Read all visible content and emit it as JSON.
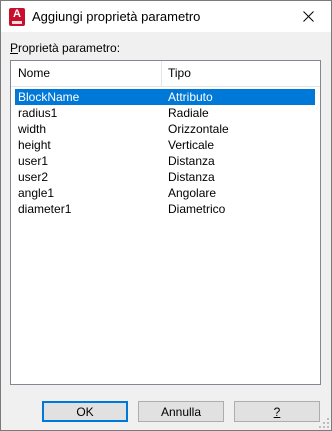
{
  "window": {
    "title": "Aggiungi proprietà parametro",
    "app_icon": "autocad-logo-icon",
    "app_icon_letter": "A",
    "accent_color": "#c8102e"
  },
  "section": {
    "label": "Proprietà parametro:"
  },
  "table": {
    "columns": [
      "Nome",
      "Tipo"
    ],
    "selected_index": 0,
    "selection_color": "#0078d7",
    "rows": [
      {
        "name": "BlockName",
        "type": "Attributo"
      },
      {
        "name": "radius1",
        "type": "Radiale"
      },
      {
        "name": "width",
        "type": "Orizzontale"
      },
      {
        "name": "height",
        "type": "Verticale"
      },
      {
        "name": "user1",
        "type": "Distanza"
      },
      {
        "name": "user2",
        "type": "Distanza"
      },
      {
        "name": "angle1",
        "type": "Angolare"
      },
      {
        "name": "diameter1",
        "type": "Diametrico"
      }
    ]
  },
  "buttons": {
    "ok": "OK",
    "cancel": "Annulla",
    "help": "?"
  }
}
